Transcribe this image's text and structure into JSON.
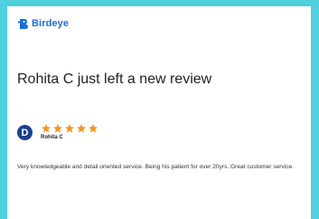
{
  "brand": {
    "name": "Birdeye",
    "icon": "birdeye-logo-icon",
    "color": "#1a6fd6"
  },
  "notification": {
    "headline": "Rohita C just left a new review"
  },
  "review": {
    "avatar_initial": "D",
    "reviewer_name": "Rohita C",
    "rating": 5,
    "max_rating": 5,
    "star_color": "#f0962a",
    "text": "Very knowledgeable and detail oriented service. Being his patient for over 20yrs. Great customer service."
  },
  "colors": {
    "background": "#4fd0dc",
    "card": "#ffffff",
    "avatar": "#1d3f8f"
  }
}
